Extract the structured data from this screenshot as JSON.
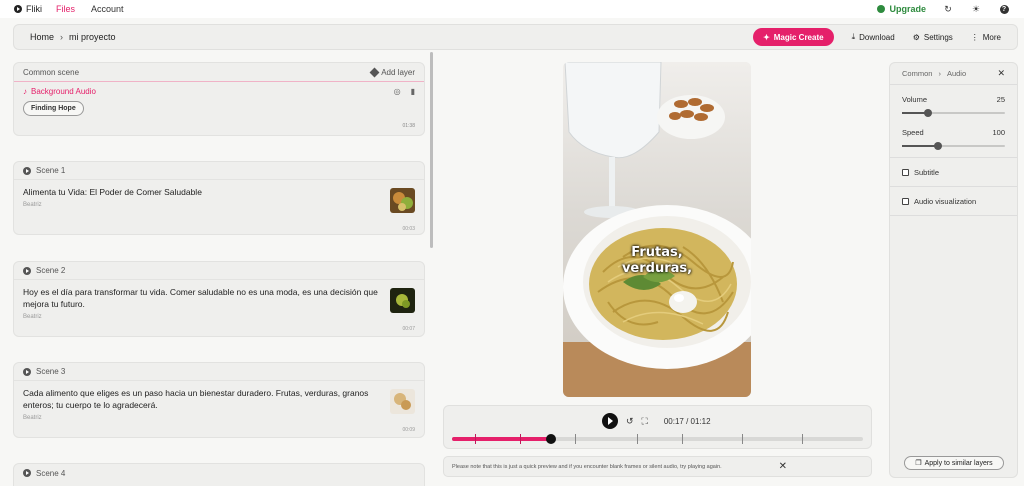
{
  "nav": {
    "brand": "Fliki",
    "links": [
      "Files",
      "Account"
    ],
    "upgrade": "Upgrade"
  },
  "header": {
    "breadcrumb": [
      "Home",
      "mi proyecto"
    ],
    "magic_create": "Magic Create",
    "download": "Download",
    "settings": "Settings",
    "more": "More"
  },
  "common_scene": {
    "label": "Common scene",
    "add_layer": "Add layer",
    "bg_audio": "Background Audio",
    "track": "Finding Hope",
    "duration": "01:38"
  },
  "scenes": [
    {
      "label": "Scene 1",
      "text": "Alimenta tu Vida: El Poder de Comer Saludable",
      "voice": "Beatriz",
      "duration": "00:03"
    },
    {
      "label": "Scene 2",
      "text": "Hoy es el día para transformar tu vida. Comer saludable no es una moda, es una decisión que mejora tu futuro.",
      "voice": "Beatriz",
      "duration": "00:07"
    },
    {
      "label": "Scene 3",
      "text": "Cada alimento que eliges es un paso hacia un bienestar duradero. Frutas, verduras, granos enteros; tu cuerpo te lo agradecerá.",
      "voice": "Beatriz",
      "duration": "00:09"
    },
    {
      "label": "Scene 4"
    }
  ],
  "video": {
    "caption_line1": "Frutas,",
    "caption_line2": "verduras,"
  },
  "player": {
    "time": "00:17 / 01:12",
    "progress": 0.24
  },
  "note": "Please note that this is just a quick preview and if you encounter blank frames or silent audio, try playing again.",
  "right_panel": {
    "breadcrumb": [
      "Common",
      "Audio"
    ],
    "volume_label": "Volume",
    "volume_value": "25",
    "volume": 0.25,
    "speed_label": "Speed",
    "speed_value": "100",
    "speed": 0.35,
    "subtitle": "Subtitle",
    "audio_viz": "Audio visualization",
    "apply": "Apply to similar layers"
  },
  "colors": {
    "accent": "#e5206a",
    "upgrade": "#2e8b3e"
  }
}
